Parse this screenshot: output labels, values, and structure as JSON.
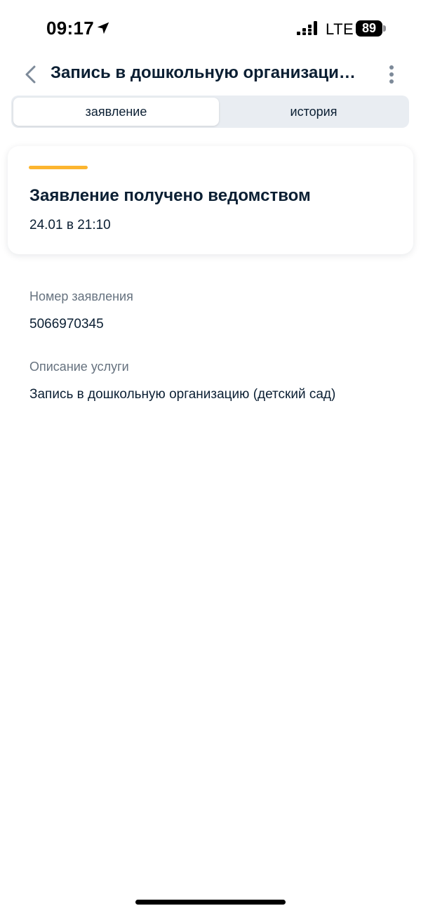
{
  "status_bar": {
    "time": "09:17",
    "network": "LTE",
    "battery": "89"
  },
  "header": {
    "title": "Запись в дошкольную организацию (детский сад)",
    "back_icon": "chevron-left-icon",
    "more_icon": "more-vertical-icon"
  },
  "tabs": [
    {
      "label": "заявление",
      "active": true
    },
    {
      "label": "история",
      "active": false
    }
  ],
  "status_card": {
    "title": "Заявление получено ведомством",
    "date": "24.01 в 21:10",
    "indicator_color": "#fcb52f"
  },
  "details": {
    "application_number_label": "Номер заявления",
    "application_number": "5066970345",
    "service_description_label": "Описание услуги",
    "service_description": "Запись в дошкольную организацию (детский сад)"
  },
  "colors": {
    "accent": "#fcb52f",
    "text_primary": "#0b1f33",
    "text_secondary": "#66727f",
    "tab_background": "#e9edf2"
  }
}
